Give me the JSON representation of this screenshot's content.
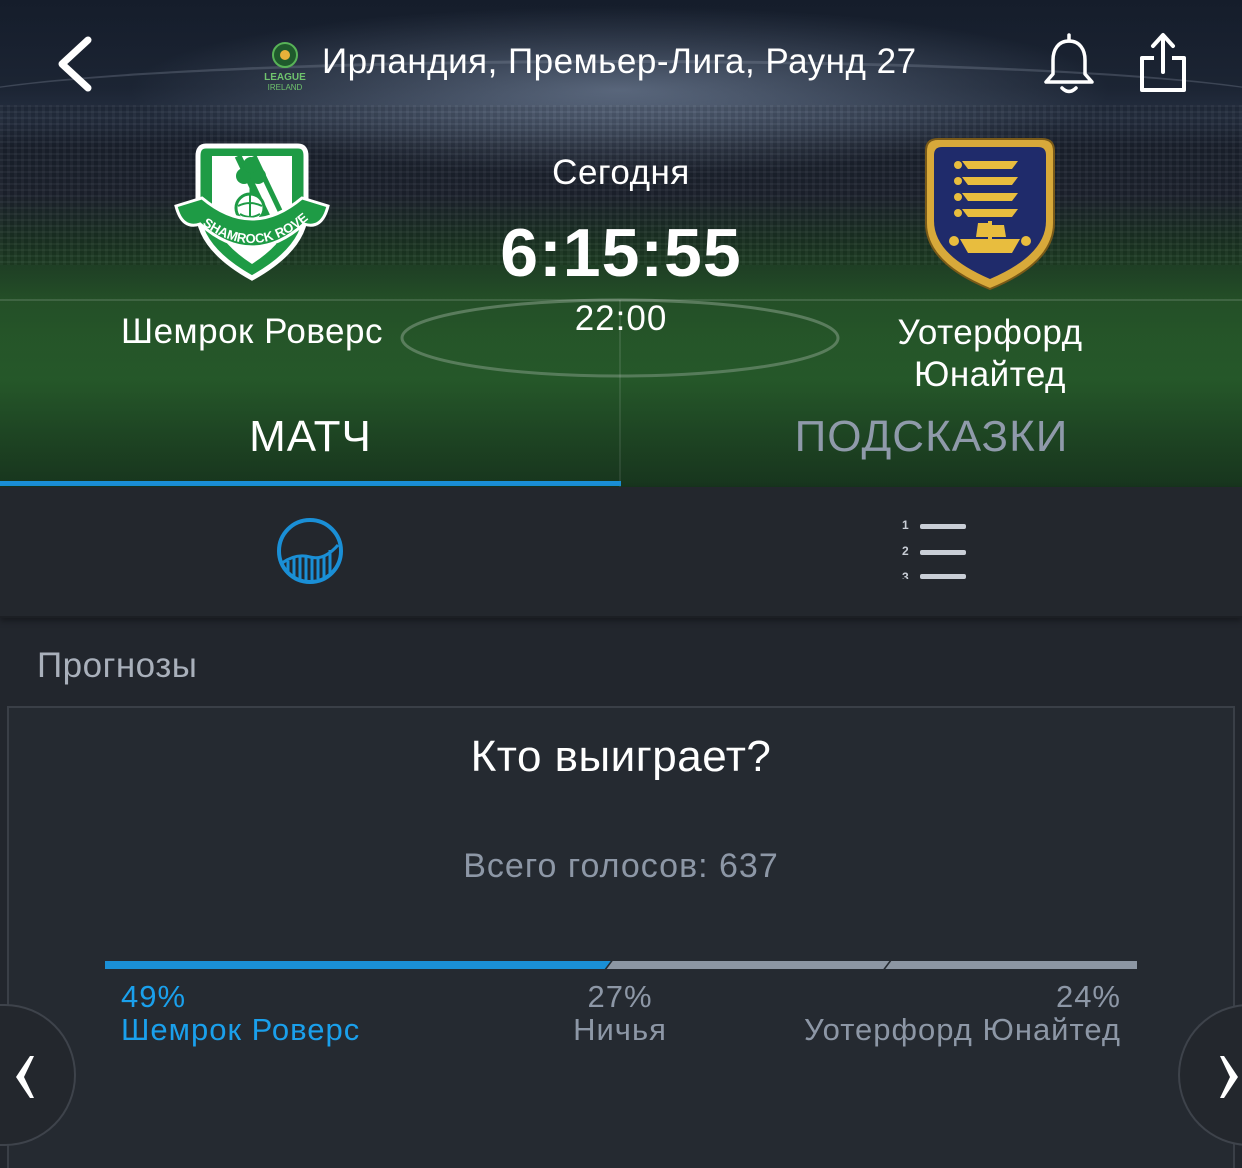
{
  "header": {
    "league_title": "Ирландия, Премьер-Лига, Раунд 27",
    "league_logo_text": "LEAGUE IRELAND",
    "home_team": "Шемрок Роверс",
    "home_crest_text": "SHAMROCK ROVERS F.C.",
    "away_team": "Уотерфорд Юнайтед",
    "day_label": "Сегодня",
    "countdown": "6:15:55",
    "kickoff_time": "22:00"
  },
  "tabs": [
    {
      "label": "МАТЧ",
      "active": true
    },
    {
      "label": "ПОДСКАЗКИ",
      "active": false
    }
  ],
  "subtabs": {
    "list_numbers": [
      "1",
      "2",
      "3"
    ]
  },
  "predictions": {
    "section_title": "Прогнозы",
    "question": "Кто выиграет?",
    "total_votes": "Всего голосов: 637",
    "options": [
      {
        "percent": "49%",
        "label": "Шемрок Роверс",
        "share": 0.49
      },
      {
        "percent": "27%",
        "label": "Ничья",
        "share": 0.27
      },
      {
        "percent": "24%",
        "label": "Уотерфорд Юнайтед",
        "share": 0.24
      }
    ]
  },
  "colors": {
    "accent": "#1a8fd6",
    "home_highlight": "#1aa0ec",
    "bar_inactive": "#8c96a3",
    "background": "#22262d"
  },
  "icons": {
    "back": "chevron-left-icon",
    "bell": "bell-icon",
    "share": "share-icon",
    "stats": "stats-chart-icon",
    "list": "numbered-list-icon",
    "prev": "chevron-left-icon",
    "next": "chevron-right-icon"
  }
}
